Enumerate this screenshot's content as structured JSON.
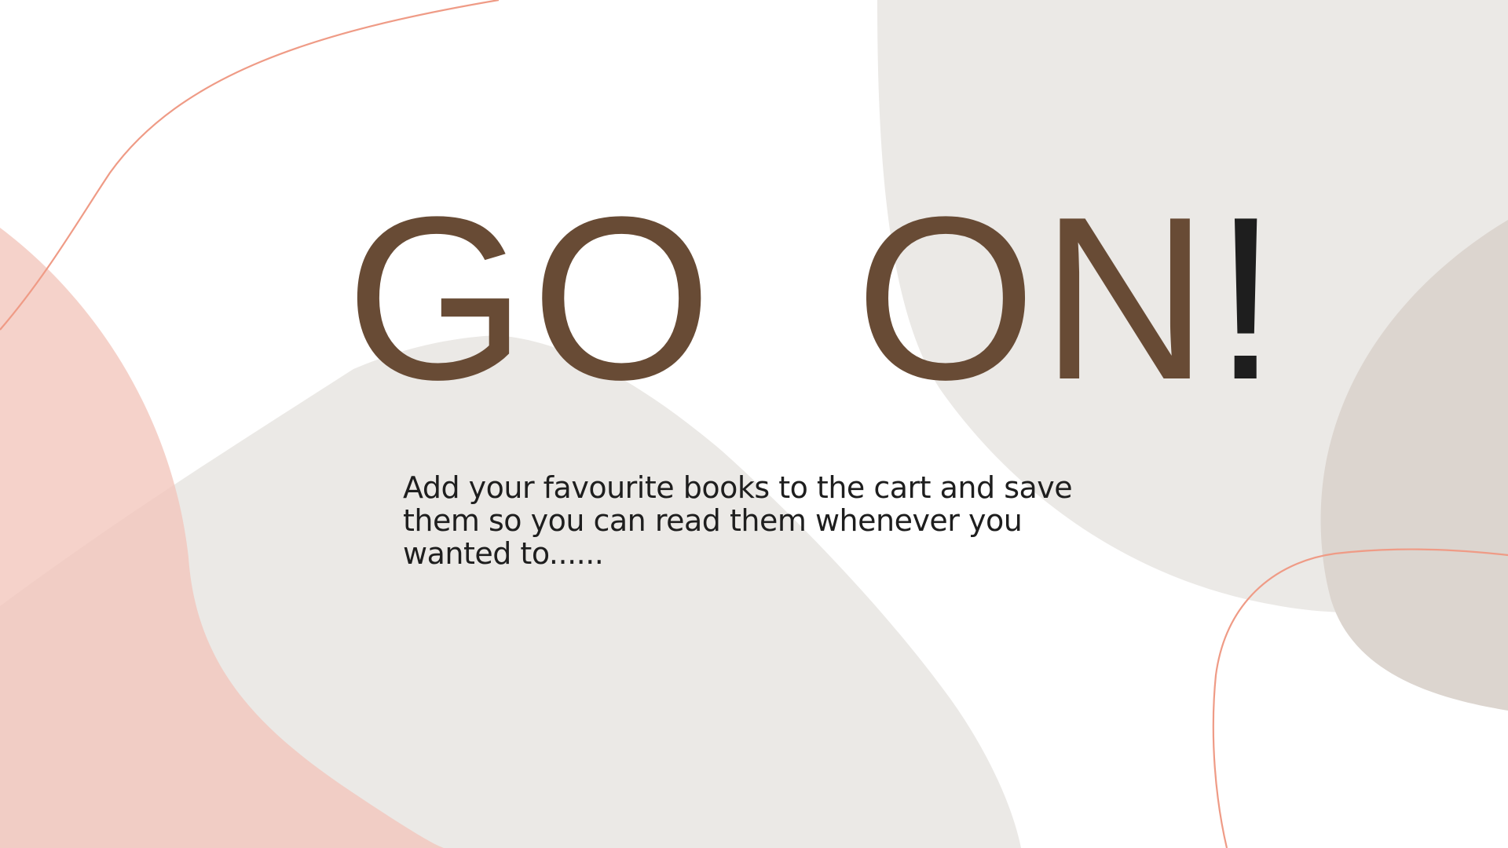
{
  "slide": {
    "headline_main": "GO  ON",
    "headline_bang": "!",
    "body": "Add your favourite books to the cart and save them so you can read them whenever you wanted to......"
  },
  "colors": {
    "headline": "#684b35",
    "exclamation": "#1e1e1e",
    "body_text": "#1e1e1e",
    "blob_pink": "#f2c5bb",
    "blob_gray": "#ebe9e6",
    "blob_gray_dark": "#dcd5cf",
    "accent_line": "#ef9b86",
    "background": "#ffffff"
  }
}
